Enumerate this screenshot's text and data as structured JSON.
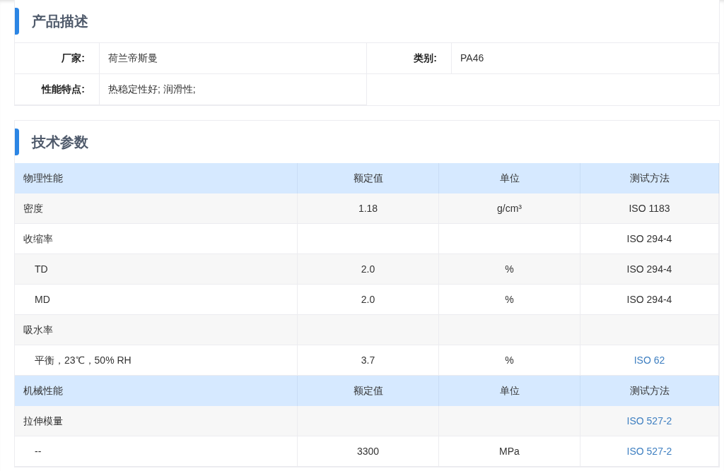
{
  "description": {
    "title": "产品描述",
    "fields": [
      {
        "label": "厂家:",
        "value": "荷兰帝斯曼"
      },
      {
        "label": "类别:",
        "value": "PA46"
      },
      {
        "label": "性能特点:",
        "value": "热稳定性好; 润滑性;"
      }
    ]
  },
  "specs": {
    "title": "技术参数",
    "sections": [
      {
        "header": {
          "name": "物理性能",
          "value": "额定值",
          "unit": "单位",
          "method": "测试方法"
        },
        "rows": [
          {
            "name": "密度",
            "value": "1.18",
            "unit": "g/cm³",
            "method": "ISO 1183",
            "method_link": false
          },
          {
            "name": "收缩率",
            "method": "ISO 294-4",
            "method_link": false,
            "children": [
              {
                "name": "TD",
                "value": "2.0",
                "unit": "%",
                "method": "ISO 294-4",
                "method_link": false
              },
              {
                "name": "MD",
                "value": "2.0",
                "unit": "%",
                "method": "ISO 294-4",
                "method_link": false
              }
            ]
          },
          {
            "name": "吸水率",
            "children": [
              {
                "name": "平衡，23℃，50% RH",
                "value": "3.7",
                "unit": "%",
                "method": "ISO 62",
                "method_link": true
              }
            ]
          }
        ]
      },
      {
        "header": {
          "name": "机械性能",
          "value": "额定值",
          "unit": "单位",
          "method": "测试方法"
        },
        "rows": [
          {
            "name": "拉伸模量",
            "method": "ISO 527-2",
            "method_link": true,
            "children": [
              {
                "name": "--",
                "value": "3300",
                "unit": "MPa",
                "method": "ISO 527-2",
                "method_link": true
              }
            ]
          }
        ]
      }
    ]
  }
}
